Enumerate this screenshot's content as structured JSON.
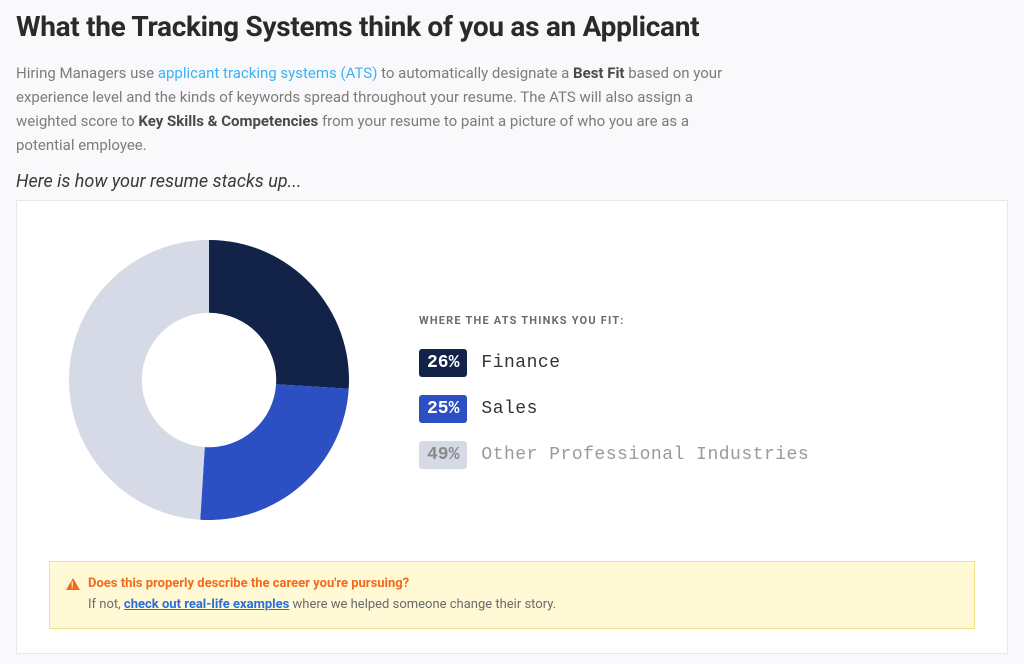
{
  "title": "What the Tracking Systems think of you as an Applicant",
  "intro": {
    "prefix": "Hiring Managers use ",
    "link_text": "applicant tracking systems (ATS)",
    "mid1": " to automatically designate a ",
    "bold1": "Best Fit",
    "mid2": " based on your experience level and the kinds of keywords spread throughout your resume. The ATS will also assign a weighted score to ",
    "bold2": "Key Skills & Competencies",
    "suffix": " from your resume to paint a picture of who you are as a potential employee."
  },
  "subhead": "Here is how your resume stacks up...",
  "legend_title": "WHERE THE ATS THINKS YOU FIT:",
  "legend": [
    {
      "pct": "26%",
      "label": "Finance",
      "color": "#132249",
      "muted": false
    },
    {
      "pct": "25%",
      "label": "Sales",
      "color": "#2c4fc4",
      "muted": false
    },
    {
      "pct": "49%",
      "label": "Other Professional Industries",
      "color": "#d6d9e6",
      "muted": true
    }
  ],
  "alert": {
    "question": "Does this properly describe the career you're pursuing?",
    "sub_prefix": "If not, ",
    "link_text": "check out real-life examples",
    "sub_suffix": " where we helped someone change their story."
  },
  "chart_data": {
    "type": "pie",
    "title": "Where the ATS thinks you fit",
    "series": [
      {
        "name": "Finance",
        "value": 26,
        "color": "#132249"
      },
      {
        "name": "Sales",
        "value": 25,
        "color": "#2c4fc4"
      },
      {
        "name": "Other Professional Industries",
        "value": 49,
        "color": "#d6d9e6"
      }
    ],
    "donut": true,
    "inner_radius_ratio": 0.48
  }
}
